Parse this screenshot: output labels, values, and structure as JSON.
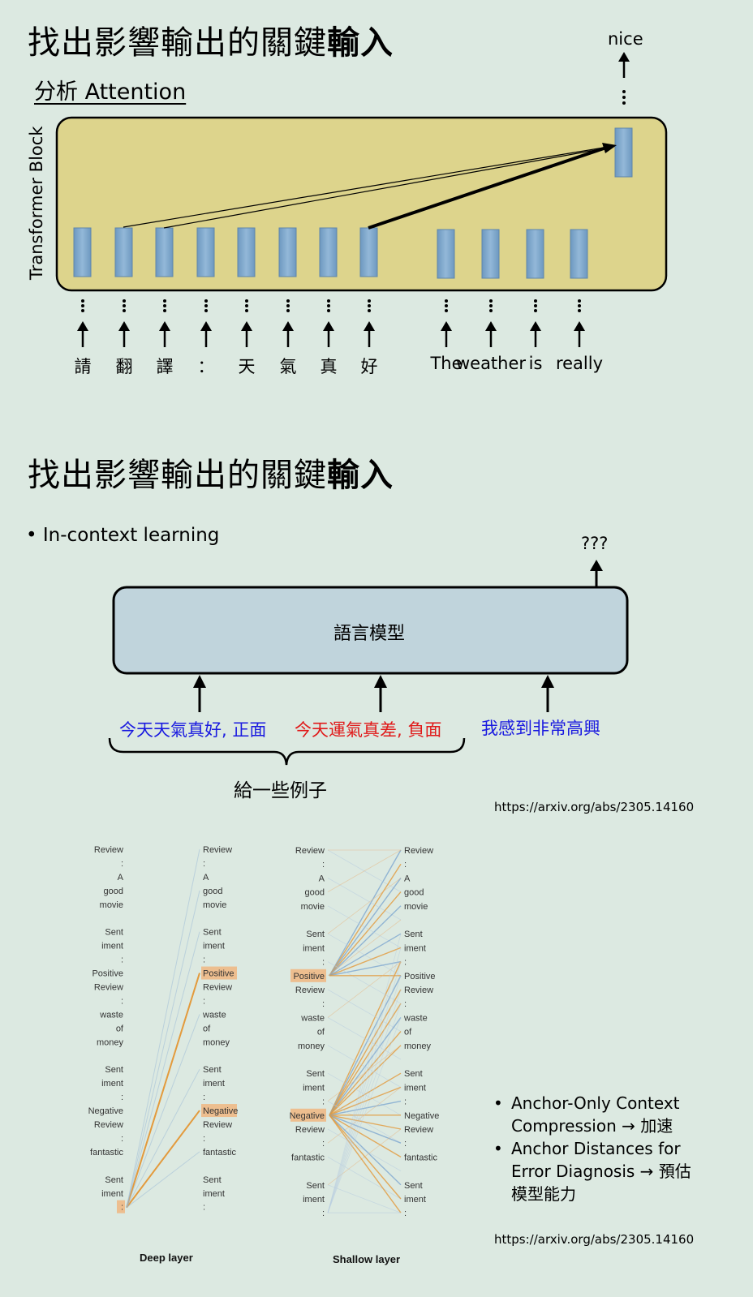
{
  "section1": {
    "title_regular": "找出影響輸出的關鍵",
    "title_bold": "輸入",
    "subtitle": "分析 Attention",
    "block_label": "Transformer Block",
    "output_token": "nice",
    "input_tokens": [
      "請",
      "翻",
      "譯",
      "：",
      "天",
      "氣",
      "真",
      "好",
      "The",
      "weather",
      "is",
      "really"
    ]
  },
  "section2": {
    "title_regular": "找出影響輸出的關鍵",
    "title_bold": "輸入",
    "bullet": "In-context learning",
    "output": "???",
    "model_label": "語言模型",
    "example1": "今天天氣真好, 正面",
    "example2": "今天運氣真差, 負面",
    "query": "我感到非常高興",
    "brace_label": "給一些例子",
    "url": "https://arxiv.org/abs/2305.14160"
  },
  "figure": {
    "deep_caption": "Deep layer",
    "shallow_caption": "Shallow layer",
    "words": [
      "Review",
      ":",
      "A",
      "good",
      "movie",
      "",
      "Sent",
      "iment",
      ":",
      "Positive",
      "Review",
      ":",
      "waste",
      "of",
      "money",
      "",
      "Sent",
      "iment",
      ":",
      "Negative",
      "Review",
      ":",
      "fantastic",
      "",
      "Sent",
      "iment",
      ":"
    ]
  },
  "section3": {
    "items": [
      {
        "line1": "Anchor-Only Context",
        "line2": "Compression → 加速"
      },
      {
        "line1": "Anchor Distances for",
        "line2": "Error Diagnosis → 預估",
        "line3": "模型能力"
      }
    ],
    "url": "https://arxiv.org/abs/2305.14160"
  },
  "colors": {
    "background": "#dce9e1",
    "block_fill": "#ddd48c",
    "token_box": "#7fa8cc",
    "model_fill": "#c0d4dc",
    "example_blue": "#1a1ae0",
    "example_red": "#e01a1a",
    "attention_orange": "#e39a3c",
    "attention_blue": "#9ab9d6"
  }
}
